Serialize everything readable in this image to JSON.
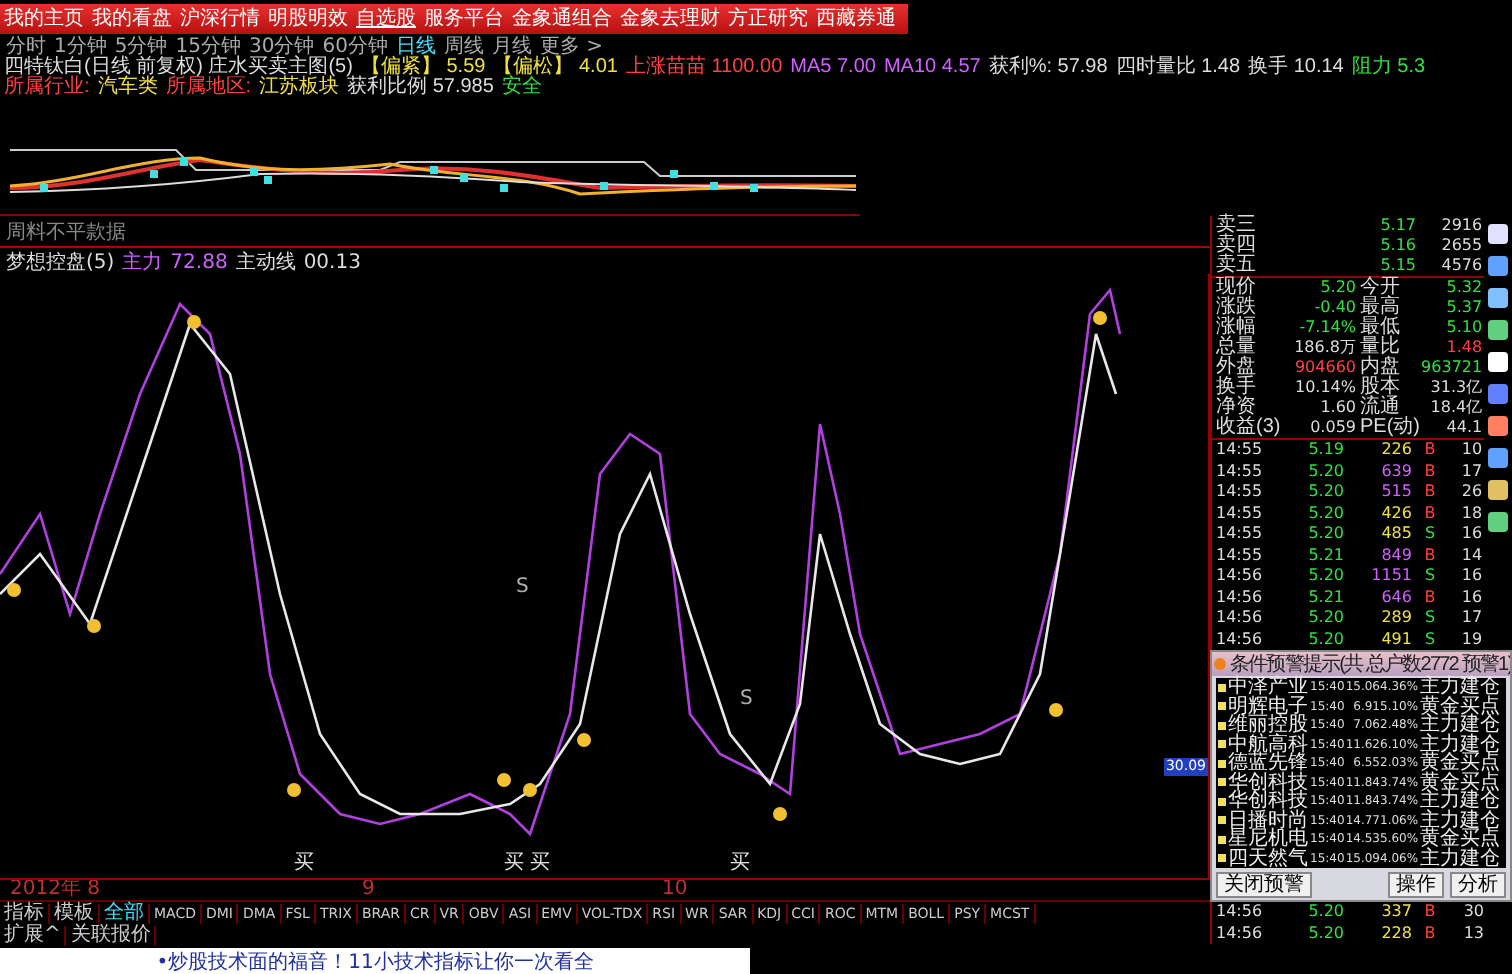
{
  "nav": [
    {
      "label": "我的主页",
      "selected": false
    },
    {
      "label": "我的看盘",
      "selected": false
    },
    {
      "label": "沪深行情",
      "selected": false
    },
    {
      "label": "明股明效",
      "selected": false
    },
    {
      "label": "自选股",
      "selected": true
    },
    {
      "label": "服务平台",
      "selected": false
    },
    {
      "label": "金象通组合",
      "selected": false
    },
    {
      "label": "金象去理财",
      "selected": false
    },
    {
      "label": "方正研究",
      "selected": false
    },
    {
      "label": "西藏券通",
      "selected": false
    }
  ],
  "periods": [
    {
      "label": "分时",
      "selected": false
    },
    {
      "label": "1分钟",
      "selected": false
    },
    {
      "label": "5分钟",
      "selected": false
    },
    {
      "label": "15分钟",
      "selected": false
    },
    {
      "label": "30分钟",
      "selected": false
    },
    {
      "label": "60分钟",
      "selected": false
    },
    {
      "label": "日线",
      "selected": true
    },
    {
      "label": "周线",
      "selected": false
    },
    {
      "label": "月线",
      "selected": false
    },
    {
      "label": "更多 >",
      "selected": false
    }
  ],
  "info_line": [
    {
      "text": "四特钛白(日线 前复权) 庄水买卖主图(5)",
      "color": "#dddddd"
    },
    {
      "text": "【偏紧】 5.59",
      "color": "#f0e040"
    },
    {
      "text": "【偏松】 4.01",
      "color": "#f0e040"
    },
    {
      "text": "上涨苗苗 1100.00",
      "color": "#ff4040"
    },
    {
      "text": "MA5 7.00",
      "color": "#d060ff"
    },
    {
      "text": "MA10 4.57",
      "color": "#d060ff"
    },
    {
      "text": "获利%: 57.98",
      "color": "#dddddd"
    },
    {
      "text": "四时量比 1.48",
      "color": "#dddddd"
    },
    {
      "text": "换手 10.14",
      "color": "#dddddd"
    },
    {
      "text": "阻力 5.3",
      "color": "#30e040"
    }
  ],
  "info_line_2": [
    {
      "text": "所属行业:",
      "color": "#ff4040"
    },
    {
      "text": "汽车类",
      "color": "#f0e040"
    },
    {
      "text": "所属地区:",
      "color": "#ff4040"
    },
    {
      "text": "江苏板块",
      "color": "#f0e040"
    },
    {
      "text": "获利比例 57.985",
      "color": "#dddddd"
    },
    {
      "text": "安全",
      "color": "#30e040"
    }
  ],
  "chart_note": "周料不平款据",
  "indicator": {
    "name": "梦想控盘(5)",
    "main_label": "主力",
    "main_value": "72.88",
    "line_label": "主动线",
    "line_value": "00.13"
  },
  "chart_markers": [
    {
      "label": "S",
      "kind": "sell"
    },
    {
      "label": "S",
      "kind": "sell"
    },
    {
      "label": "买",
      "kind": "buy"
    },
    {
      "label": "买",
      "kind": "buy"
    },
    {
      "label": "买",
      "kind": "buy"
    },
    {
      "label": "买",
      "kind": "buy"
    }
  ],
  "axis_marker": "30.09",
  "dates": [
    "2012年 8",
    "9",
    "10"
  ],
  "indicator_tabs": [
    {
      "label": "指标",
      "selected": false
    },
    {
      "label": "模板",
      "selected": false
    },
    {
      "label": "全部",
      "selected": true
    },
    {
      "label": "MACD",
      "selected": false
    },
    {
      "label": "DMI",
      "selected": false
    },
    {
      "label": "DMA",
      "selected": false
    },
    {
      "label": "FSL",
      "selected": false
    },
    {
      "label": "TRIX",
      "selected": false
    },
    {
      "label": "BRAR",
      "selected": false
    },
    {
      "label": "CR",
      "selected": false
    },
    {
      "label": "VR",
      "selected": false
    },
    {
      "label": "OBV",
      "selected": false
    },
    {
      "label": "ASI",
      "selected": false
    },
    {
      "label": "EMV",
      "selected": false
    },
    {
      "label": "VOL-TDX",
      "selected": false
    },
    {
      "label": "RSI",
      "selected": false
    },
    {
      "label": "WR",
      "selected": false
    },
    {
      "label": "SAR",
      "selected": false
    },
    {
      "label": "KDJ",
      "selected": false
    },
    {
      "label": "CCI",
      "selected": false
    },
    {
      "label": "ROC",
      "selected": false
    },
    {
      "label": "MTM",
      "selected": false
    },
    {
      "label": "BOLL",
      "selected": false
    },
    {
      "label": "PSY",
      "selected": false
    },
    {
      "label": "MCST",
      "selected": false
    }
  ],
  "bottom_tabs": [
    "扩展^",
    "关联报价"
  ],
  "ad_text": "•炒股技术面的福音！11小技术指标让你一次看全",
  "order_book": [
    {
      "label": "卖三",
      "price": "5.17",
      "volume": "2916"
    },
    {
      "label": "卖四",
      "price": "5.16",
      "volume": "2655"
    },
    {
      "label": "卖五",
      "price": "5.15",
      "volume": "4576"
    }
  ],
  "stats": [
    {
      "label": "现价",
      "value": "5.20",
      "color": "#30e040"
    },
    {
      "label": "今开",
      "value": "5.32",
      "color": "#30e040"
    },
    {
      "label": "涨跌",
      "value": "-0.40",
      "color": "#30e040"
    },
    {
      "label": "最高",
      "value": "5.37",
      "color": "#30e040"
    },
    {
      "label": "涨幅",
      "value": "-7.14%",
      "color": "#30e040"
    },
    {
      "label": "最低",
      "value": "5.10",
      "color": "#30e040"
    },
    {
      "label": "总量",
      "value": "186.8万",
      "color": "#dddddd"
    },
    {
      "label": "量比",
      "value": "1.48",
      "color": "#ff4040"
    },
    {
      "label": "外盘",
      "value": "904660",
      "color": "#ff4040"
    },
    {
      "label": "内盘",
      "value": "963721",
      "color": "#30e040"
    },
    {
      "label": "换手",
      "value": "10.14%",
      "color": "#dddddd"
    },
    {
      "label": "股本",
      "value": "31.3亿",
      "color": "#dddddd"
    },
    {
      "label": "净资",
      "value": "1.60",
      "color": "#dddddd"
    },
    {
      "label": "流通",
      "value": "18.4亿",
      "color": "#dddddd"
    },
    {
      "label": "收益(3)",
      "value": "0.059",
      "color": "#dddddd"
    },
    {
      "label": "PE(动)",
      "value": "44.1",
      "color": "#dddddd"
    }
  ],
  "trades": [
    {
      "time": "14:55",
      "price": "5.19",
      "volume": "226",
      "big": false,
      "side": "B",
      "kind": "buy",
      "count": "10"
    },
    {
      "time": "14:55",
      "price": "5.20",
      "volume": "639",
      "big": true,
      "side": "B",
      "kind": "buy",
      "count": "17"
    },
    {
      "time": "14:55",
      "price": "5.20",
      "volume": "515",
      "big": true,
      "side": "B",
      "kind": "buy",
      "count": "26"
    },
    {
      "time": "14:55",
      "price": "5.20",
      "volume": "426",
      "big": false,
      "side": "B",
      "kind": "buy",
      "count": "18"
    },
    {
      "time": "14:55",
      "price": "5.20",
      "volume": "485",
      "big": false,
      "side": "S",
      "kind": "sell",
      "count": "16"
    },
    {
      "time": "14:55",
      "price": "5.21",
      "volume": "849",
      "big": true,
      "side": "B",
      "kind": "buy",
      "count": "14"
    },
    {
      "time": "14:56",
      "price": "5.20",
      "volume": "1151",
      "big": true,
      "side": "S",
      "kind": "sell",
      "count": "16"
    },
    {
      "time": "14:56",
      "price": "5.21",
      "volume": "646",
      "big": true,
      "side": "B",
      "kind": "buy",
      "count": "16"
    },
    {
      "time": "14:56",
      "price": "5.20",
      "volume": "289",
      "big": false,
      "side": "S",
      "kind": "sell",
      "count": "17"
    },
    {
      "time": "14:56",
      "price": "5.20",
      "volume": "491",
      "big": false,
      "side": "S",
      "kind": "sell",
      "count": "19"
    }
  ],
  "alert": {
    "title": "条件预警提示(共 总户数2772 预警1)",
    "rows": [
      {
        "name": "中泽产业",
        "time": "15:40",
        "price": "15.06",
        "change": "4.36%",
        "signal": "主力建仓"
      },
      {
        "name": "明辉电子",
        "time": "15:40",
        "price": "6.91",
        "change": "5.10%",
        "signal": "黄金买点"
      },
      {
        "name": "维丽控股",
        "time": "15:40",
        "price": "7.06",
        "change": "2.48%",
        "signal": "主力建仓"
      },
      {
        "name": "中航高科",
        "time": "15:40",
        "price": "11.62",
        "change": "6.10%",
        "signal": "主力建仓"
      },
      {
        "name": "德蓝先锋",
        "time": "15:40",
        "price": "6.55",
        "change": "2.03%",
        "signal": "黄金买点"
      },
      {
        "name": "华创科技",
        "time": "15:40",
        "price": "11.84",
        "change": "3.74%",
        "signal": "黄金买点"
      },
      {
        "name": "华创科技",
        "time": "15:40",
        "price": "11.84",
        "change": "3.74%",
        "signal": "主力建仓"
      },
      {
        "name": "日播时尚",
        "time": "15:40",
        "price": "14.77",
        "change": "1.06%",
        "signal": "主力建仓"
      },
      {
        "name": "星尼机电",
        "time": "15:40",
        "price": "14.53",
        "change": "5.60%",
        "signal": "黄金买点"
      },
      {
        "name": "四天然气",
        "time": "15:40",
        "price": "15.09",
        "change": "4.06%",
        "signal": "主力建仓"
      }
    ],
    "buttons": [
      "关闭预警",
      "操作",
      "分析"
    ]
  },
  "trades_after": [
    {
      "time": "14:56",
      "price": "5.20",
      "volume": "337",
      "big": false,
      "side": "B",
      "kind": "buy",
      "count": "30"
    },
    {
      "time": "14:56",
      "price": "5.20",
      "volume": "228",
      "big": false,
      "side": "B",
      "kind": "buy",
      "count": "13"
    }
  ]
}
